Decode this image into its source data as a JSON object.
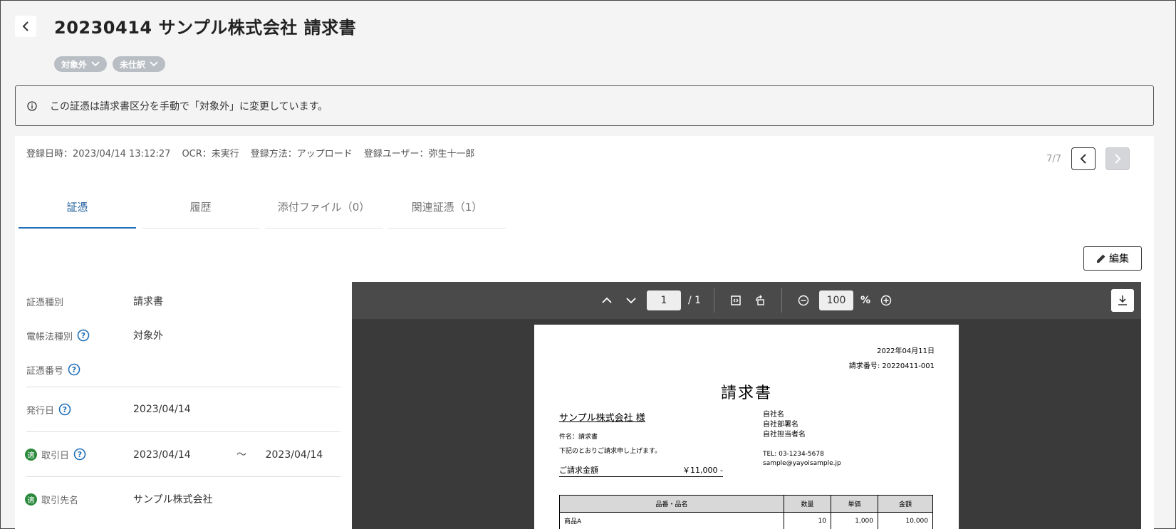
{
  "header": {
    "title": "20230414 サンプル株式会社 請求書",
    "tags": [
      "対象外",
      "未仕訳"
    ]
  },
  "notice": {
    "text": "この証憑は請求書区分を手動で「対象外」に変更しています。"
  },
  "meta": {
    "registered_at": "登録日時：2023/04/14 13:12:27",
    "ocr": "OCR：未実行",
    "method": "登録方法：アップロード",
    "user": "登録ユーザー：弥生十一郎"
  },
  "pager": {
    "count": "7/7"
  },
  "tabs": [
    {
      "label": "証憑",
      "active": true
    },
    {
      "label": "履歴",
      "active": false
    },
    {
      "label": "添付ファイル（0）",
      "active": false
    },
    {
      "label": "関連証憑（1）",
      "active": false
    }
  ],
  "edit_button": {
    "label": "編集"
  },
  "fields": {
    "doc_type": {
      "label": "証憑種別",
      "value": "請求書"
    },
    "ledger_type": {
      "label": "電帳法種別",
      "value": "対象外"
    },
    "doc_number": {
      "label": "証憑番号",
      "value": ""
    },
    "issue_date": {
      "label": "発行日",
      "value": "2023/04/14"
    },
    "transaction_date": {
      "label": "取引日",
      "from": "2023/04/14",
      "separator": "〜",
      "to": "2023/04/14",
      "badge": "適"
    },
    "partner": {
      "label": "取引先名",
      "value": "サンプル株式会社",
      "badge": "適"
    }
  },
  "viewer": {
    "page": "1",
    "total_pages": "/ 1",
    "zoom": "100",
    "zoom_unit": "%"
  },
  "invoice": {
    "date": "2022年04月11日",
    "number": "請求番号: 20220411-001",
    "title": "請求書",
    "to": "サンプル株式会社 様",
    "subject": "件名：請求書",
    "request": "下記のとおりご請求申し上げます。",
    "amount_label": "ご請求金額",
    "amount_value": "￥11,000 -",
    "sender": [
      "自社名",
      "自社部署名",
      "自社担当者名"
    ],
    "contact": [
      "TEL: 03-1234-5678",
      "sample@yayoisample.jp"
    ],
    "table": {
      "headers": [
        "品番・品名",
        "数量",
        "単価",
        "金額"
      ],
      "rows": [
        [
          "商品A",
          "10",
          "1,000",
          "10,000"
        ]
      ]
    }
  }
}
